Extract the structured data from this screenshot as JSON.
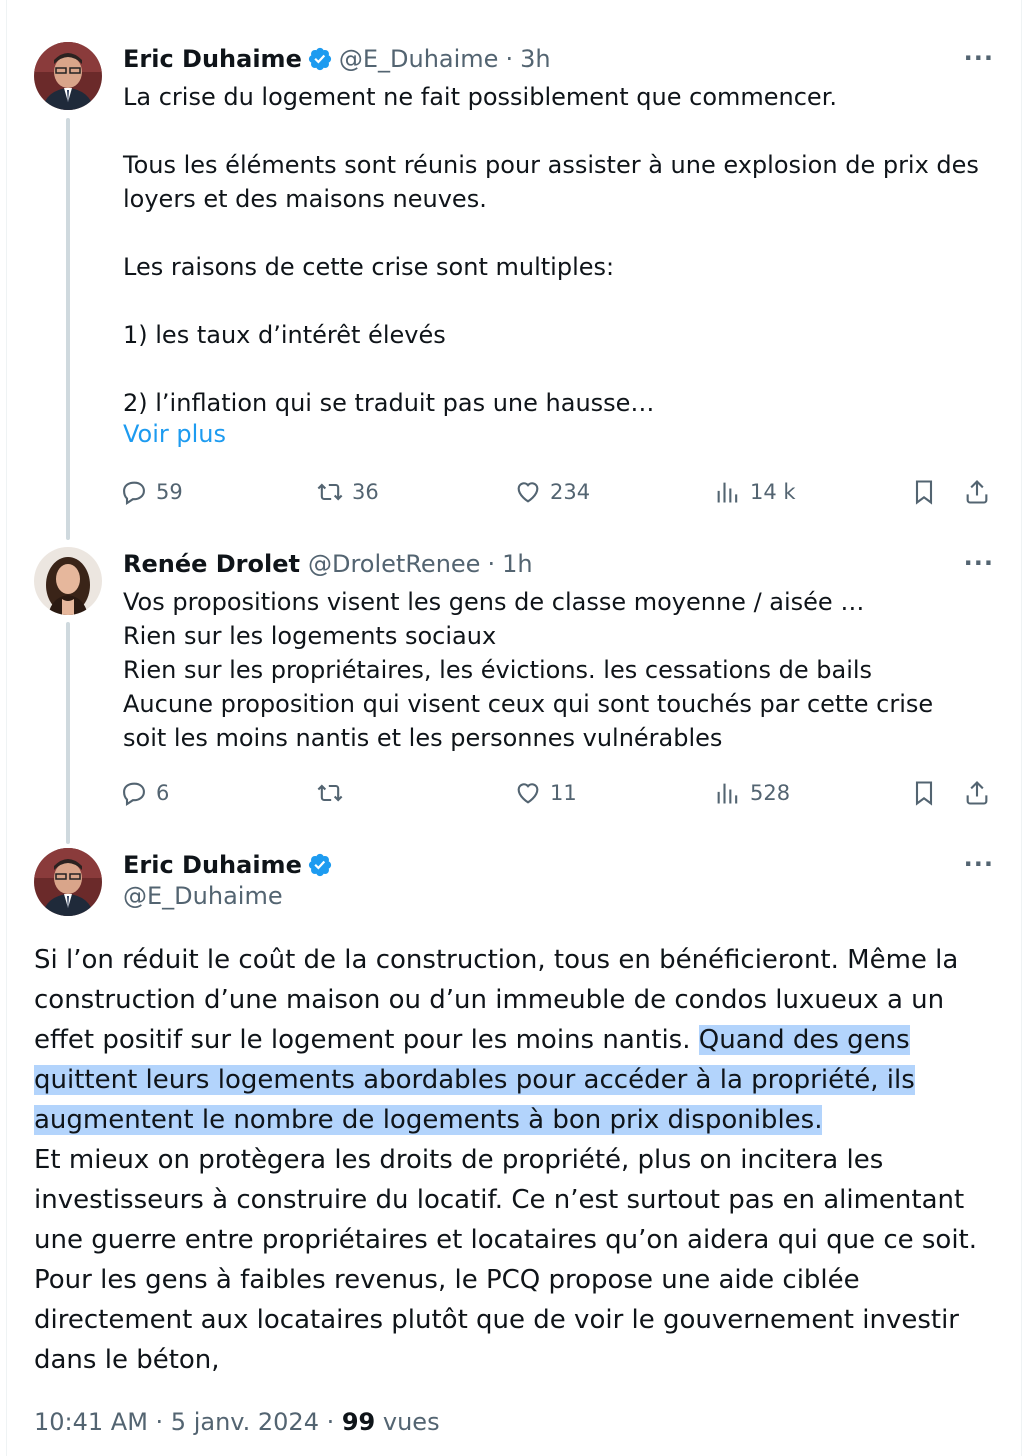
{
  "tweet1": {
    "name": "Eric Duhaime",
    "handle": "@E_Duhaime",
    "separator": "·",
    "time": "3h",
    "more": "···",
    "text": "La crise du logement ne fait possiblement que commencer.\n\nTous les éléments sont réunis pour assister à une explosion de prix des loyers et des maisons neuves.\n\nLes raisons de cette crise sont multiples:\n\n1) les taux d’intérêt élevés\n\n2) l’inflation qui se traduit pas une hausse…",
    "show_more": "Voir plus",
    "replies": "59",
    "reposts": "36",
    "likes": "234",
    "views": "14 k"
  },
  "tweet2": {
    "name": "Renée Drolet",
    "handle": "@DroletRenee",
    "separator": "·",
    "time": "1h",
    "more": "···",
    "text": "Vos propositions visent les gens de classe moyenne / aisée …\nRien sur les logements sociaux\nRien sur les propriétaires, les évictions. les cessations de bails\nAucune proposition qui visent ceux qui sont touchés par cette crise soit les moins nantis et les personnes vulnérables",
    "replies": "6",
    "reposts": "",
    "likes": "11",
    "views": "528"
  },
  "tweet3": {
    "name": "Eric Duhaime",
    "handle": "@E_Duhaime",
    "more": "···",
    "text_part1": "Si l’on réduit le coût de la construction, tous en bénéficieront. Même la construction d’une maison ou d’un immeuble de condos luxueux a un effet positif sur le logement pour les moins nantis. ",
    "text_highlighted": "Quand des gens quittent leurs logements abordables pour accéder à la propriété, ils augmentent le nombre de logements à bon prix disponibles.",
    "text_part2": "Et mieux on protègera les droits de propriété, plus on incitera les investisseurs à construire du locatif. Ce n’est surtout pas en alimentant une guerre entre propriétaires et locataires qu’on aidera qui que ce soit.",
    "text_part3": "Pour les gens à faibles revenus, le PCQ propose une aide ciblée directement aux locataires plutôt que de voir le gouvernement investir dans le béton,",
    "timestamp": "10:41 AM · 5 janv. 2024 · ",
    "view_count": "99",
    "view_label": " vues"
  },
  "colors": {
    "verified": "#1d9bf0",
    "link": "#1d9bf0",
    "secondary": "#536471",
    "highlight": "#b3d4fc",
    "thread_line": "#cfd9de"
  },
  "icons": [
    "verified-badge-icon",
    "more-icon",
    "reply-icon",
    "repost-icon",
    "like-icon",
    "views-icon",
    "bookmark-icon",
    "share-icon"
  ]
}
